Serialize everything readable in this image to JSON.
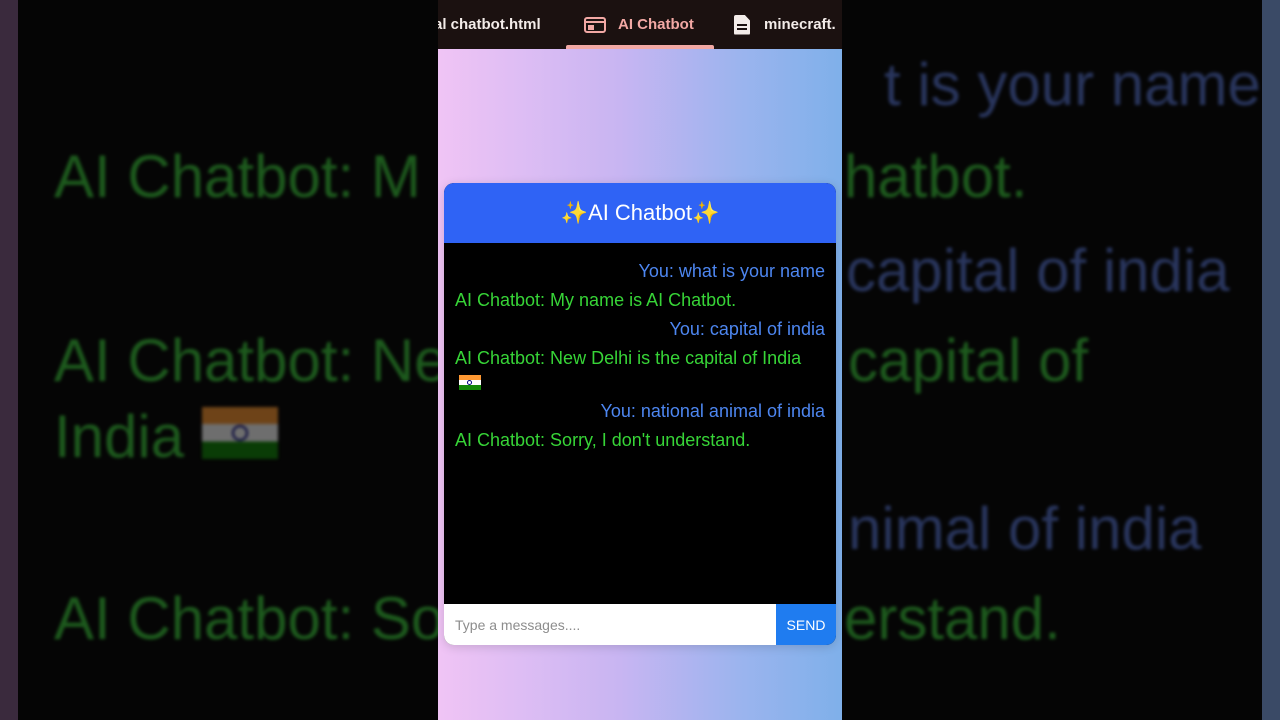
{
  "tabs": [
    {
      "label": "al chatbot.html"
    },
    {
      "label": "AI Chatbot",
      "active": true,
      "icon": "browser-window-icon"
    },
    {
      "label": "minecraft.",
      "icon": "document-icon"
    }
  ],
  "chat": {
    "title": "✨AI Chatbot✨",
    "messages": [
      {
        "sender": "user",
        "text": "You: what is your name"
      },
      {
        "sender": "bot",
        "text": "AI Chatbot: My name is AI Chatbot."
      },
      {
        "sender": "user",
        "text": "You: capital of india"
      },
      {
        "sender": "bot",
        "text": "AI Chatbot: New Delhi is the capital of India",
        "emoji": "india-flag-icon"
      },
      {
        "sender": "user",
        "text": "You: national animal of india"
      },
      {
        "sender": "bot",
        "text": "AI Chatbot: Sorry, I don't understand."
      }
    ],
    "input_placeholder": "Type a messages....",
    "input_value": "",
    "send_label": "SEND"
  },
  "background": {
    "lines": [
      {
        "sender": "user",
        "text": "t is your name"
      },
      {
        "sender": "bot",
        "text": "AI Chatbot: M"
      },
      {
        "sender": "bot",
        "text": "hatbot."
      },
      {
        "sender": "user",
        "text": "capital of india"
      },
      {
        "sender": "bot",
        "text": "AI Chatbot: Ne"
      },
      {
        "sender": "bot",
        "text": "capital of"
      },
      {
        "sender": "bot",
        "text": "India"
      },
      {
        "sender": "user",
        "text": "nimal of india"
      },
      {
        "sender": "bot",
        "text": "AI Chatbot: So"
      },
      {
        "sender": "bot",
        "text": "erstand."
      }
    ]
  },
  "colors": {
    "header": "#2f63f5",
    "user_text": "#4d86f0",
    "bot_text": "#37d437",
    "send_button": "#1f7cf0",
    "active_tab": "#f2a8a4"
  }
}
